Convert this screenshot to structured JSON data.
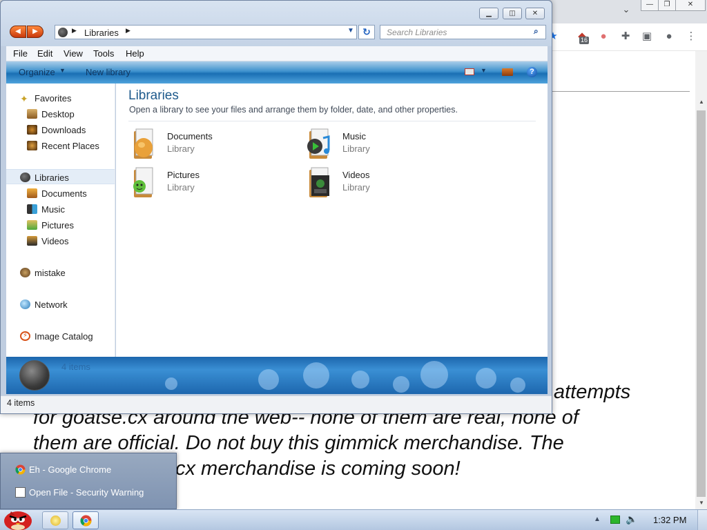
{
  "background_page": {
    "tab_overflow_icon": "chevron-down-icon",
    "extension_badge": "16",
    "article_lines": [
      "attempts",
      "for goatse.cx around the web-- none of them are real, none of",
      "them are official. Do not buy this gimmick merchandise. The",
      "cx merchandise is coming soon!"
    ]
  },
  "explorer": {
    "address": {
      "location": "Libraries"
    },
    "search": {
      "placeholder": "Search Libraries"
    },
    "menu": [
      "File",
      "Edit",
      "View",
      "Tools",
      "Help"
    ],
    "commands": {
      "organize": "Organize",
      "new_library": "New library"
    },
    "nav": {
      "favorites": {
        "label": "Favorites",
        "items": [
          "Desktop",
          "Downloads",
          "Recent Places"
        ]
      },
      "libraries": {
        "label": "Libraries",
        "items": [
          "Documents",
          "Music",
          "Pictures",
          "Videos"
        ]
      },
      "homegroup": {
        "label": "mistake"
      },
      "network": {
        "label": "Network"
      },
      "catalog": {
        "label": "Image Catalog"
      }
    },
    "content": {
      "title": "Libraries",
      "subtitle": "Open a library to see your files and arrange them by folder, date, and other properties.",
      "libraries": [
        {
          "name": "Documents",
          "type": "Library"
        },
        {
          "name": "Music",
          "type": "Library"
        },
        {
          "name": "Pictures",
          "type": "Library"
        },
        {
          "name": "Videos",
          "type": "Library"
        }
      ]
    },
    "details_pane": {
      "count": "4 items"
    },
    "status_bar": {
      "count": "4 items"
    }
  },
  "taskbar_popup": {
    "items": [
      "Eh - Google Chrome",
      "Open File - Security Warning"
    ]
  },
  "taskbar": {
    "clock": "1:32 PM"
  },
  "colors": {
    "accent": "#1e5a8c",
    "command_bar": "#1a6fb4",
    "taskbar": "#c9d7ea"
  }
}
